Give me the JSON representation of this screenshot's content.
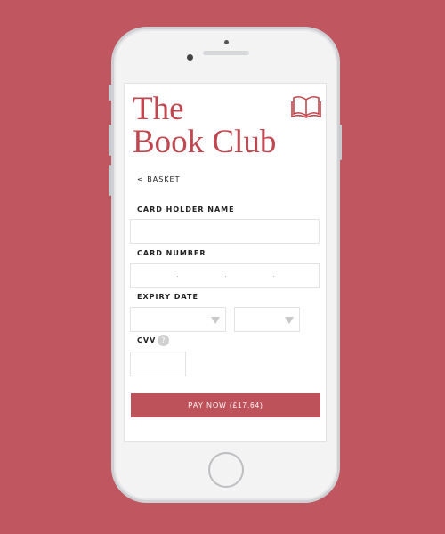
{
  "app": {
    "title_line1": "The",
    "title_line2": "Book Club",
    "logo_icon": "open-book-icon",
    "accent": "#c0474f",
    "background": "#c0565f"
  },
  "nav": {
    "back_label": "< BASKET"
  },
  "form": {
    "card_holder": {
      "label": "CARD HOLDER NAME",
      "value": ""
    },
    "card_number": {
      "label": "CARD NUMBER",
      "value": ""
    },
    "expiry": {
      "label": "EXPIRY DATE",
      "month": "",
      "year": ""
    },
    "cvv": {
      "label": "CVV",
      "help_icon": "?",
      "value": ""
    },
    "pay_label": "PAY NOW (£17.64)"
  }
}
